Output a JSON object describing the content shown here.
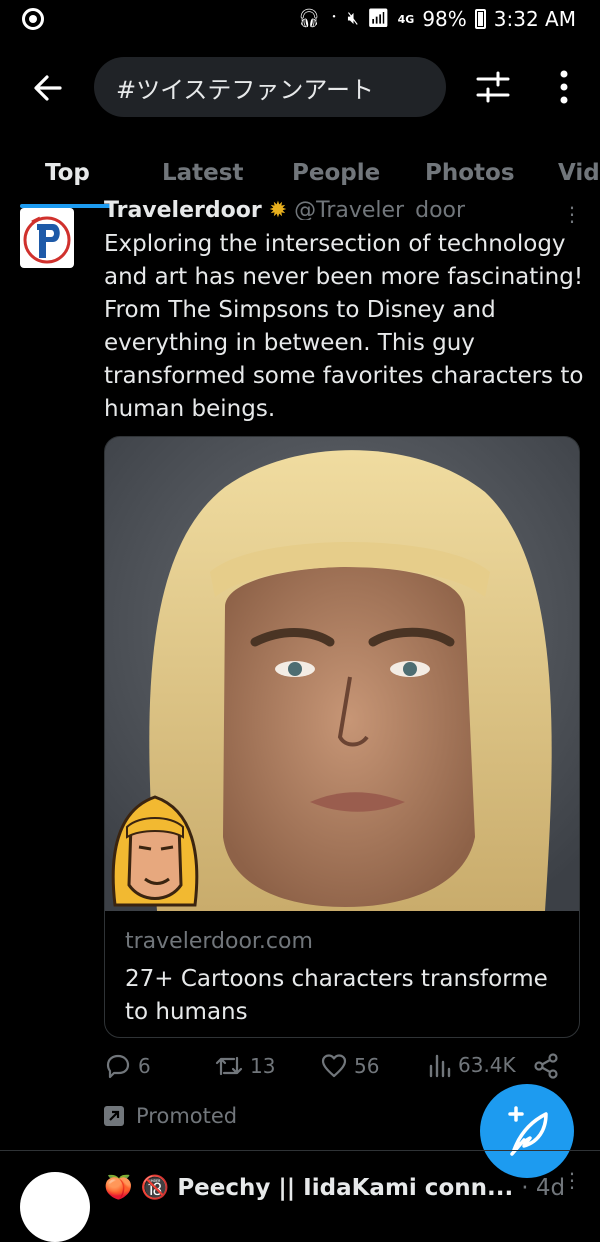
{
  "status_bar": {
    "battery": "98%",
    "time": "3:32 AM",
    "network": "4G"
  },
  "header": {
    "search_query": "#ツイステファンアート"
  },
  "tabs": [
    {
      "label": "Top",
      "active": true
    },
    {
      "label": "Latest",
      "active": false
    },
    {
      "label": "People",
      "active": false
    },
    {
      "label": "Photos",
      "active": false
    },
    {
      "label": "Vid",
      "active": false
    }
  ],
  "tweet": {
    "author_name": "Travelerdoor",
    "author_handle": "@Traveler_door",
    "text": "Exploring the intersection of technology\nand art has never been more fascinating!\nFrom The Simpsons to Disney and\neverything in between. This guy\ntransformed some favorites characters to\nhuman beings.",
    "card": {
      "domain": "travelerdoor.com",
      "title": "27+ Cartoons characters transforme to humans"
    },
    "actions": {
      "replies": "6",
      "retweets": "13",
      "likes": "56",
      "views": "63.4K"
    },
    "promoted_label": "Promoted"
  },
  "next_tweet": {
    "emoji_prefix": "🍑 🔞",
    "author_name": "Peechy || IidaKami conn...",
    "time": "· 4d"
  },
  "colors": {
    "accent": "#1d9bf0",
    "background": "#000000",
    "secondary_text": "#71767b"
  }
}
